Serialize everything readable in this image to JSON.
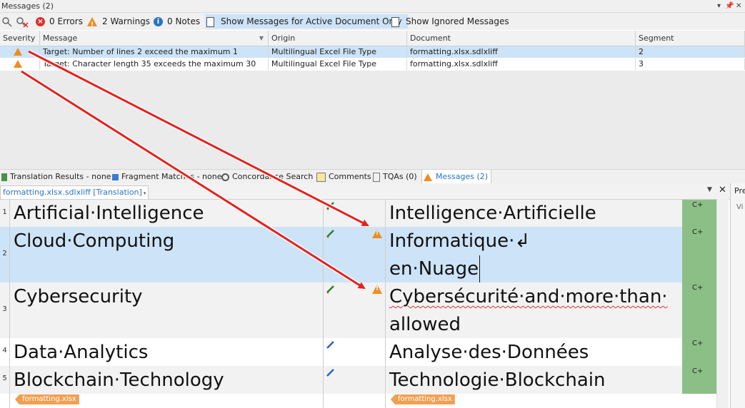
{
  "messages_panel": {
    "title": "Messages (2)",
    "controls": [
      "▾",
      "📌",
      "✕"
    ],
    "toolbar": {
      "errors_label": "0 Errors",
      "warnings_label": "2 Warnings",
      "notes_label": "0 Notes",
      "active_doc_label": "Show Messages for Active Document Only",
      "ignored_label": "Show Ignored Messages"
    },
    "columns": [
      "Severity",
      "Message",
      "Origin",
      "Document",
      "Segment"
    ],
    "rows": [
      {
        "message": "Target: Number of lines 2 exceed the maximum 1",
        "origin": "Multilingual Excel File Type",
        "document": "formatting.xlsx.sdlxliff",
        "segment": "2"
      },
      {
        "message": "Target: Character length 35 exceeds the maximum 30",
        "origin": "Multilingual Excel File Type",
        "document": "formatting.xlsx.sdlxliff",
        "segment": "3"
      }
    ]
  },
  "bottom_tabs": [
    "Translation Results - none",
    "Fragment Matches - none",
    "Concordance Search",
    "Comments",
    "TQAs (0)",
    "Messages (2)"
  ],
  "editor": {
    "doc_tab": "formatting.xlsx.sdlxliff [Translation]",
    "right_panel_label": "Pre",
    "right_panel_sub": "Vi",
    "segments": [
      {
        "num": "1",
        "source": "Artificial·Intelligence",
        "target_line1": "Intelligence·Artificielle",
        "target_line2": "",
        "status": "C+"
      },
      {
        "num": "2",
        "source": "Cloud·Computing",
        "target_line1": "Informatique·↲",
        "target_line2": "en·Nuage",
        "status": "C+"
      },
      {
        "num": "3",
        "source": "Cybersecurity",
        "target_line1": "Cybersécurité·and·more·than·",
        "target_line2": "allowed",
        "status": "C+"
      },
      {
        "num": "4",
        "source": "Data·Analytics",
        "target_line1": "Analyse·des·Données",
        "target_line2": "",
        "status": "C+"
      },
      {
        "num": "5",
        "source": "Blockchain·Technology",
        "target_line1": "Technologie·Blockchain",
        "target_line2": "",
        "status": "C+"
      }
    ],
    "end_tag_source": "formatting.xlsx",
    "end_tag_target": "formatting.xlsx"
  },
  "colors": {
    "warning": "#f08c22",
    "arrow": "#e8201c",
    "status_green": "#8cbf86",
    "selected_row": "#cde3f7"
  }
}
